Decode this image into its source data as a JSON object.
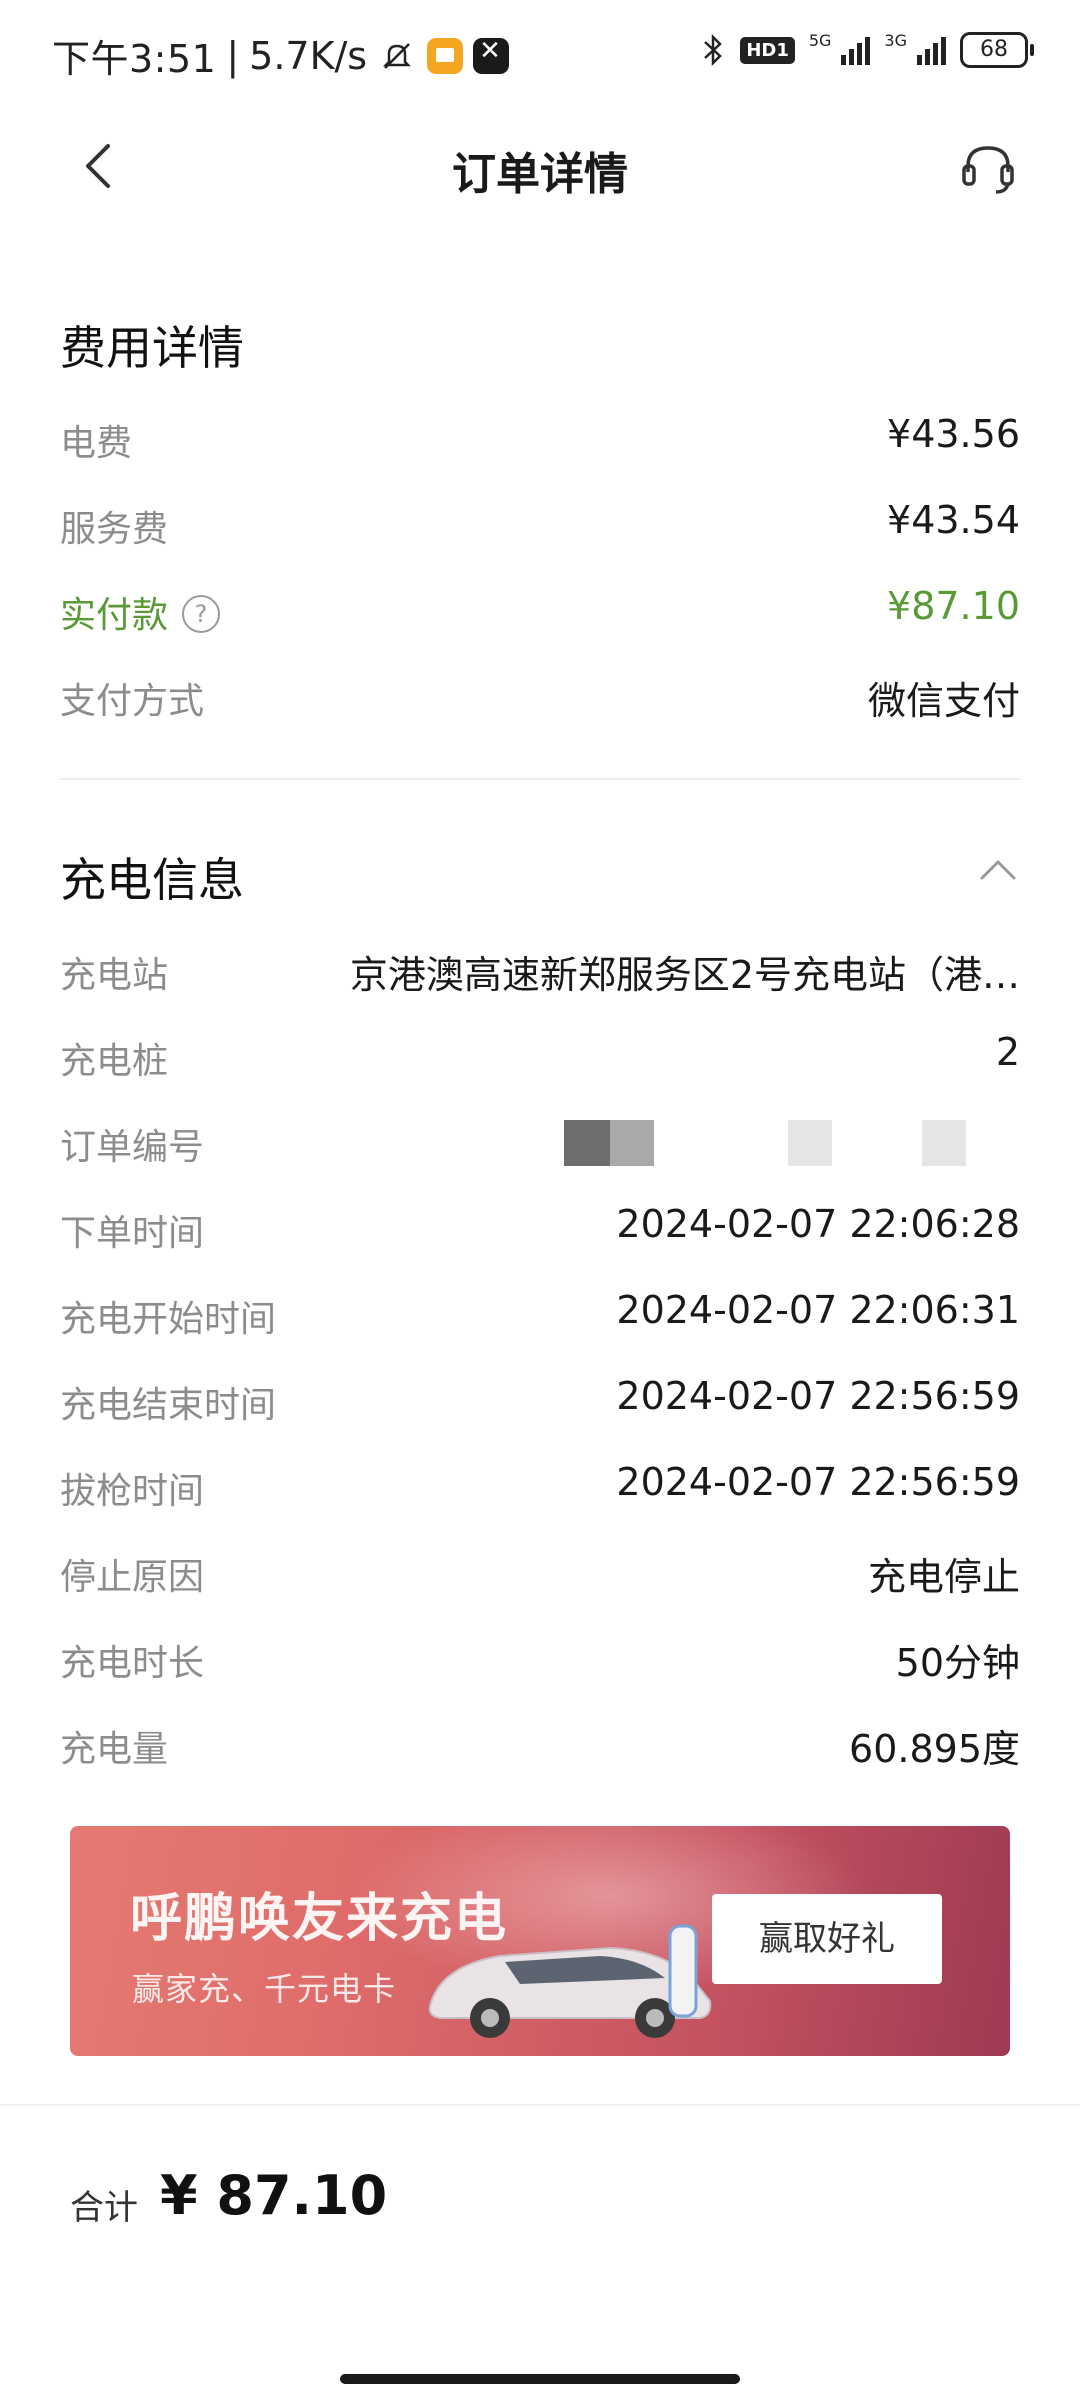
{
  "status_bar": {
    "time": "下午3:51",
    "speed": "5.7K/s",
    "hd": "HD1",
    "net1": "5G",
    "net2": "3G",
    "battery": "68"
  },
  "header": {
    "title": "订单详情"
  },
  "fee": {
    "title": "费用详情",
    "rows": [
      {
        "label": "电费",
        "value": "¥43.56"
      },
      {
        "label": "服务费",
        "value": "¥43.54"
      },
      {
        "label": "实付款",
        "value": "¥87.10"
      },
      {
        "label": "支付方式",
        "value": "微信支付"
      }
    ],
    "help_icon_glyph": "?",
    "paid_color": "#5a9a36"
  },
  "charging": {
    "title": "充电信息",
    "rows": [
      {
        "label": "充电站",
        "value": "京港澳高速新郑服务区2号充电站（港…"
      },
      {
        "label": "充电桩",
        "value": "2"
      },
      {
        "label": "订单编号",
        "value": ""
      },
      {
        "label": "下单时间",
        "value": "2024-02-07 22:06:28"
      },
      {
        "label": "充电开始时间",
        "value": "2024-02-07 22:06:31"
      },
      {
        "label": "充电结束时间",
        "value": "2024-02-07 22:56:59"
      },
      {
        "label": "拔枪时间",
        "value": "2024-02-07 22:56:59"
      },
      {
        "label": "停止原因",
        "value": "充电停止"
      },
      {
        "label": "充电时长",
        "value": "50分钟"
      },
      {
        "label": "充电量",
        "value": "60.895度"
      }
    ]
  },
  "banner": {
    "title": "呼鹏唤友来充电",
    "subtitle": "赢家充、千元电卡",
    "button": "赢取好礼"
  },
  "footer": {
    "total_label": "合计",
    "total_value": "¥ 87.10"
  }
}
